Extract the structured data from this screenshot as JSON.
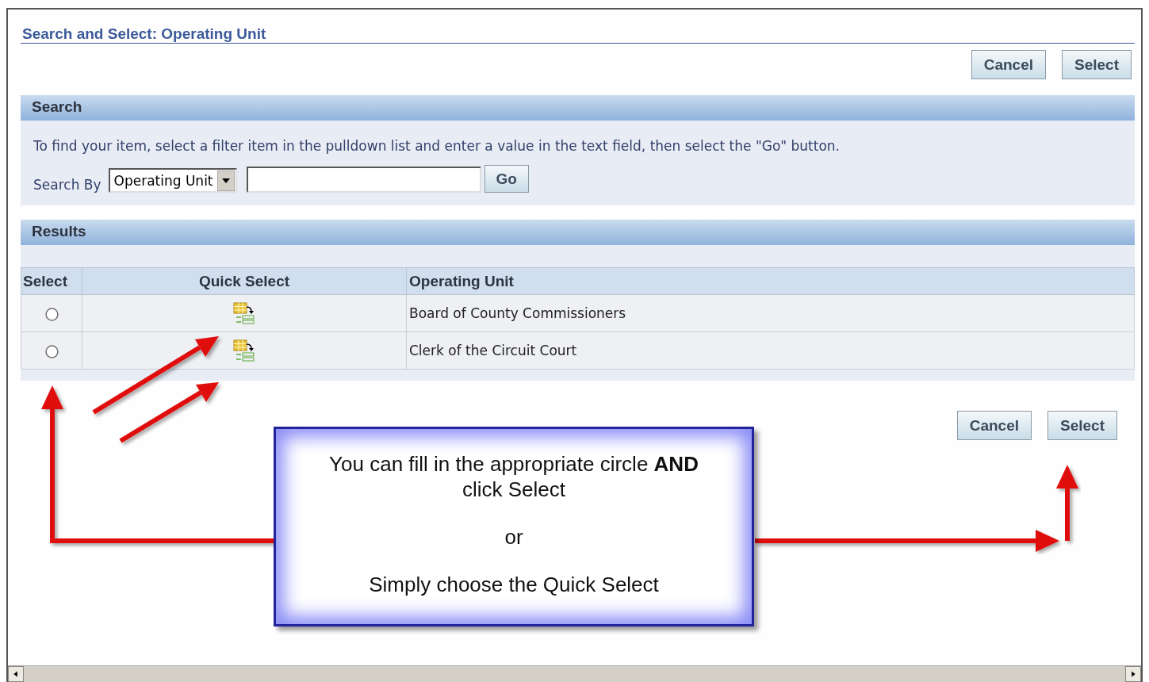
{
  "page": {
    "title": "Search and Select: Operating Unit"
  },
  "top_buttons": [
    "Cancel",
    "Select"
  ],
  "search": {
    "header": "Search",
    "instructions": "To find your item, select a filter item in the pulldown list and enter a value in the text field, then select the \"Go\" button.",
    "search_by_label": "Search By",
    "filter_value": "Operating Unit",
    "go_button": "Go"
  },
  "results": {
    "header": "Results",
    "columns": [
      "Select",
      "Quick Select",
      "Operating Unit"
    ],
    "rows": [
      {
        "selected": false,
        "operating_unit": "Board of County Commissioners"
      },
      {
        "selected": false,
        "operating_unit": "Clerk of the Circuit Court"
      }
    ]
  },
  "bottom_buttons": [
    "Cancel",
    "Select"
  ],
  "callout": {
    "lines": [
      "You can fill in the appropriate circle **AND** click Select",
      "or",
      "Simply choose the Quick Select"
    ]
  }
}
